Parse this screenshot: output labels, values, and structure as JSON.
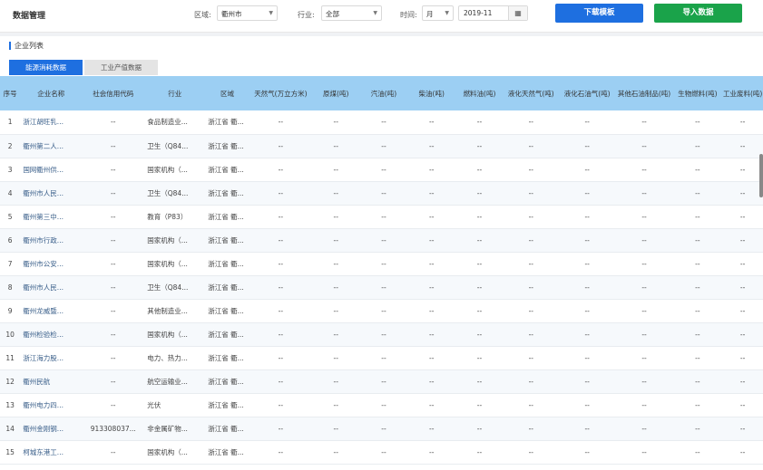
{
  "header": {
    "title": "数据管理",
    "region_label": "区域:",
    "region_value": "衢州市",
    "industry_label": "行业:",
    "industry_value": "全部",
    "time_label": "时间:",
    "period_value": "月",
    "date_value": "2019-11",
    "download_label": "下载模板",
    "import_label": "导入数据"
  },
  "section": {
    "title": "企业列表",
    "tabs": [
      "能源消耗数据",
      "工业产值数据"
    ]
  },
  "table": {
    "columns": [
      "序号",
      "企业名称",
      "社会信用代码",
      "行业",
      "区域",
      "天然气(万立方米)",
      "原煤(吨)",
      "汽油(吨)",
      "柴油(吨)",
      "燃料油(吨)",
      "液化天然气(吨)",
      "液化石油气(吨)",
      "其他石油制品(吨)",
      "生物燃料(吨)",
      "工业废料(吨)"
    ],
    "rows": [
      {
        "no": "1",
        "name": "浙江胡旺乳...",
        "code": "--",
        "industry": "食品制造业...",
        "area": "浙江省 衢...",
        "vals": [
          "--",
          "--",
          "--",
          "--",
          "--",
          "--",
          "--",
          "--",
          "--",
          "--"
        ]
      },
      {
        "no": "2",
        "name": "衢州第二人...",
        "code": "--",
        "industry": "卫生（Q84...",
        "area": "浙江省 衢...",
        "vals": [
          "--",
          "--",
          "--",
          "--",
          "--",
          "--",
          "--",
          "--",
          "--",
          "--"
        ]
      },
      {
        "no": "3",
        "name": "国网衢州供...",
        "code": "--",
        "industry": "国家机构（...",
        "area": "浙江省 衢...",
        "vals": [
          "--",
          "--",
          "--",
          "--",
          "--",
          "--",
          "--",
          "--",
          "--",
          "--"
        ]
      },
      {
        "no": "4",
        "name": "衢州市人民...",
        "code": "--",
        "industry": "卫生（Q84...",
        "area": "浙江省 衢...",
        "vals": [
          "--",
          "--",
          "--",
          "--",
          "--",
          "--",
          "--",
          "--",
          "--",
          "--"
        ]
      },
      {
        "no": "5",
        "name": "衢州第三中...",
        "code": "--",
        "industry": "教育（P83）",
        "area": "浙江省 衢...",
        "vals": [
          "--",
          "--",
          "--",
          "--",
          "--",
          "--",
          "--",
          "--",
          "--",
          "--"
        ]
      },
      {
        "no": "6",
        "name": "衢州市行政...",
        "code": "--",
        "industry": "国家机构（...",
        "area": "浙江省 衢...",
        "vals": [
          "--",
          "--",
          "--",
          "--",
          "--",
          "--",
          "--",
          "--",
          "--",
          "--"
        ]
      },
      {
        "no": "7",
        "name": "衢州市公安...",
        "code": "--",
        "industry": "国家机构（...",
        "area": "浙江省 衢...",
        "vals": [
          "--",
          "--",
          "--",
          "--",
          "--",
          "--",
          "--",
          "--",
          "--",
          "--"
        ]
      },
      {
        "no": "8",
        "name": "衢州市人民...",
        "code": "--",
        "industry": "卫生（Q84...",
        "area": "浙江省 衢...",
        "vals": [
          "--",
          "--",
          "--",
          "--",
          "--",
          "--",
          "--",
          "--",
          "--",
          "--"
        ]
      },
      {
        "no": "9",
        "name": "衢州龙威暨...",
        "code": "--",
        "industry": "其他制造业...",
        "area": "浙江省 衢...",
        "vals": [
          "--",
          "--",
          "--",
          "--",
          "--",
          "--",
          "--",
          "--",
          "--",
          "--"
        ]
      },
      {
        "no": "10",
        "name": "衢州检验检...",
        "code": "--",
        "industry": "国家机构（...",
        "area": "浙江省 衢...",
        "vals": [
          "--",
          "--",
          "--",
          "--",
          "--",
          "--",
          "--",
          "--",
          "--",
          "--"
        ]
      },
      {
        "no": "11",
        "name": "浙江海力股...",
        "code": "--",
        "industry": "电力、热力...",
        "area": "浙江省 衢...",
        "vals": [
          "--",
          "--",
          "--",
          "--",
          "--",
          "--",
          "--",
          "--",
          "--",
          "--"
        ]
      },
      {
        "no": "12",
        "name": "衢州民航",
        "code": "--",
        "industry": "航空运输业...",
        "area": "浙江省 衢...",
        "vals": [
          "--",
          "--",
          "--",
          "--",
          "--",
          "--",
          "--",
          "--",
          "--",
          "--"
        ]
      },
      {
        "no": "13",
        "name": "衢州电力四...",
        "code": "--",
        "industry": "光伏",
        "area": "浙江省 衢...",
        "vals": [
          "--",
          "--",
          "--",
          "--",
          "--",
          "--",
          "--",
          "--",
          "--",
          "--"
        ]
      },
      {
        "no": "14",
        "name": "衢州金刚钢...",
        "code": "913308037...",
        "industry": "非金属矿物...",
        "area": "浙江省 衢...",
        "vals": [
          "--",
          "--",
          "--",
          "--",
          "--",
          "--",
          "--",
          "--",
          "--",
          "--"
        ]
      },
      {
        "no": "15",
        "name": "柯城东港工...",
        "code": "--",
        "industry": "国家机构（...",
        "area": "浙江省 衢...",
        "vals": [
          "--",
          "--",
          "--",
          "--",
          "--",
          "--",
          "--",
          "--",
          "--",
          "--"
        ]
      }
    ]
  }
}
